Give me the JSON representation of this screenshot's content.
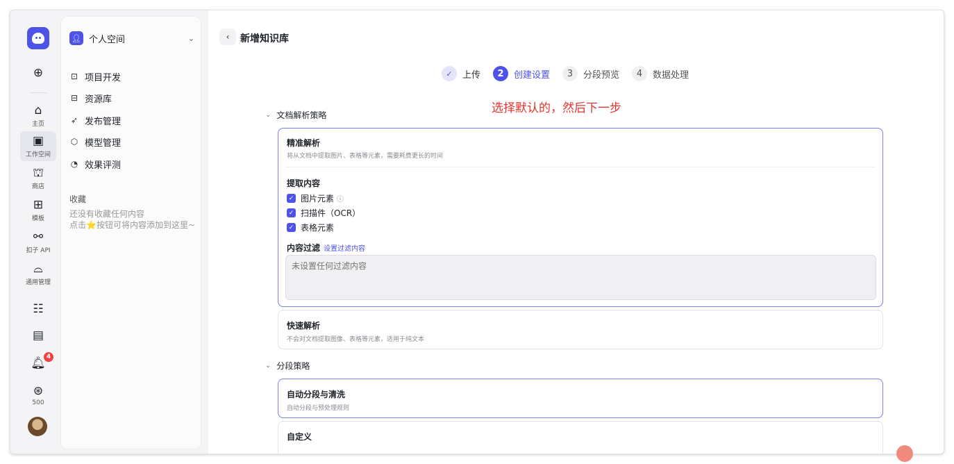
{
  "rail": {
    "items": [
      {
        "name": "create",
        "icon": "⊕",
        "label": ""
      },
      {
        "name": "home",
        "icon": "⌂",
        "label": "主页"
      },
      {
        "name": "workspace",
        "icon": "▣",
        "label": "工作空间"
      },
      {
        "name": "store",
        "icon": "⛫",
        "label": "商店"
      },
      {
        "name": "template",
        "icon": "⊞",
        "label": "模板"
      },
      {
        "name": "api",
        "icon": "⚯",
        "label": "扣子 API"
      },
      {
        "name": "general",
        "icon": "⌓",
        "label": "通用管理"
      }
    ],
    "apps_icon": "☷",
    "docs_icon": "▤",
    "bell_badge": "4",
    "points_label": "500"
  },
  "sidebar": {
    "workspace": "个人空间",
    "nav": [
      {
        "icon": "⊡",
        "label": "项目开发"
      },
      {
        "icon": "⊟",
        "label": "资源库"
      },
      {
        "icon": "➶",
        "label": "发布管理"
      },
      {
        "icon": "⬡",
        "label": "模型管理"
      },
      {
        "icon": "◔",
        "label": "效果评测"
      }
    ],
    "favorites_title": "收藏",
    "favorites_empty_1": "还没有收藏任何内容",
    "favorites_empty_2": "点击⭐按钮可将内容添加到这里~"
  },
  "header": {
    "title": "新增知识库"
  },
  "steps": [
    {
      "num": "✓",
      "label": "上传",
      "state": "done"
    },
    {
      "num": "2",
      "label": "创建设置",
      "state": "current"
    },
    {
      "num": "3",
      "label": "分段预览",
      "state": "todo"
    },
    {
      "num": "4",
      "label": "数据处理",
      "state": "todo"
    }
  ],
  "annotation": "选择默认的，然后下一步",
  "parse": {
    "section": "文档解析策略",
    "precise": {
      "title": "精准解析",
      "desc": "将从文档中提取图片、表格等元素，需要耗费更长的时间",
      "extract_title": "提取内容",
      "options": [
        "图片元素",
        "扫描件（OCR）",
        "表格元素"
      ],
      "filter_label": "内容过滤",
      "filter_link": "设置过滤内容",
      "filter_placeholder": "未设置任何过滤内容"
    },
    "fast": {
      "title": "快速解析",
      "desc": "不会对文档提取图像、表格等元素，适用于纯文本"
    }
  },
  "segment": {
    "section": "分段策略",
    "auto": {
      "title": "自动分段与清洗",
      "desc": "自动分段与预处理规则"
    },
    "custom": {
      "title": "自定义"
    }
  },
  "colors": {
    "accent": "#4d53e8",
    "annotation": "#e8322d",
    "badge": "#f04141"
  }
}
